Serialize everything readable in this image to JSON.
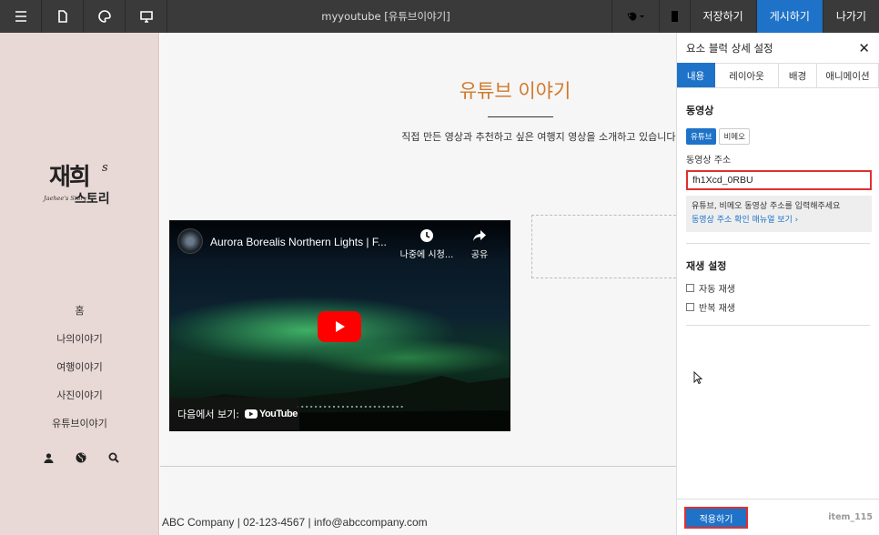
{
  "toolbar": {
    "title": "myyoutube [유튜브이야기]",
    "save_label": "저장하기",
    "publish_label": "게시하기",
    "exit_label": "나가기"
  },
  "sidebar": {
    "logo_main": "재희",
    "logo_sub": "스토리",
    "logo_s": "s",
    "logo_eng": "Jaehee's Story",
    "menu": [
      {
        "label": "홈"
      },
      {
        "label": "나의이야기"
      },
      {
        "label": "여행이야기"
      },
      {
        "label": "사진이야기"
      },
      {
        "label": "유튜브이야기"
      }
    ]
  },
  "main": {
    "heading": "유튜브 이야기",
    "description": "직접 만든 영상과 추천하고 싶은 여행지 영상을 소개하고 있습니다.",
    "video": {
      "title": "Aurora Borealis Northern Lights | F...",
      "watch_later": "나중에 시청...",
      "share": "공유",
      "watch_on": "다음에서 보기:",
      "youtube": "YouTube"
    },
    "footer": "ABC Company | 02-123-4567 | info@abccompany.com"
  },
  "panel": {
    "title": "요소 블럭 상세 설정",
    "tabs": [
      {
        "label": "내용"
      },
      {
        "label": "레이아웃"
      },
      {
        "label": "배경"
      },
      {
        "label": "애니메이션"
      }
    ],
    "video_section": "동영상",
    "source_youtube": "유튜브",
    "source_vimeo": "비메오",
    "url_label": "동영상 주소",
    "url_value": "fh1Xcd_0RBU",
    "hint": "유튜브, 비메오 동영상 주소를 입력해주세요",
    "hint_link": "동영상 주소 확인 매뉴얼 보기 ›",
    "play_section": "재생 설정",
    "autoplay": "자동 재생",
    "loop": "반복 재생",
    "apply_label": "적용하기",
    "item_id": "item_115"
  },
  "colors": {
    "accent": "#1e72c8",
    "heading": "#d07a2c",
    "highlight": "#e03030",
    "sidebar_bg": "#e8d8d6"
  }
}
